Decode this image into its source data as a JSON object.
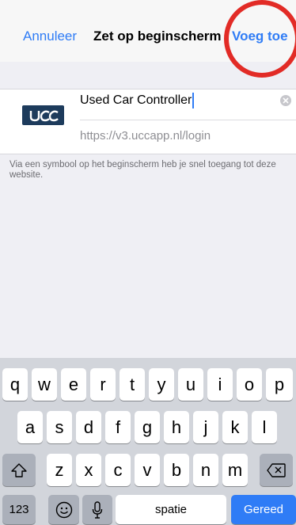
{
  "navbar": {
    "cancel_label": "Annuleer",
    "title": "Zet op beginscherm",
    "add_label": "Voeg toe"
  },
  "bookmark": {
    "icon_name": "ucc-logo-icon",
    "icon_text": "UCC",
    "name_value": "Used Car Controller",
    "url": "https://v3.uccapp.nl/login"
  },
  "helper_text": "Via een symbool op het beginscherm heb je snel toegang tot deze website.",
  "keyboard": {
    "row1": [
      "q",
      "w",
      "e",
      "r",
      "t",
      "y",
      "u",
      "i",
      "o",
      "p"
    ],
    "row2": [
      "a",
      "s",
      "d",
      "f",
      "g",
      "h",
      "j",
      "k",
      "l"
    ],
    "row3": [
      "z",
      "x",
      "c",
      "v",
      "b",
      "n",
      "m"
    ],
    "numbers_label": "123",
    "space_label": "spatie",
    "done_label": "Gereed",
    "icons": [
      "shift-icon",
      "backspace-icon",
      "emoji-icon",
      "microphone-icon"
    ]
  },
  "colors": {
    "accent": "#2f7cf6",
    "annotation": "#e22b26",
    "brand": "#1d3b5c"
  }
}
